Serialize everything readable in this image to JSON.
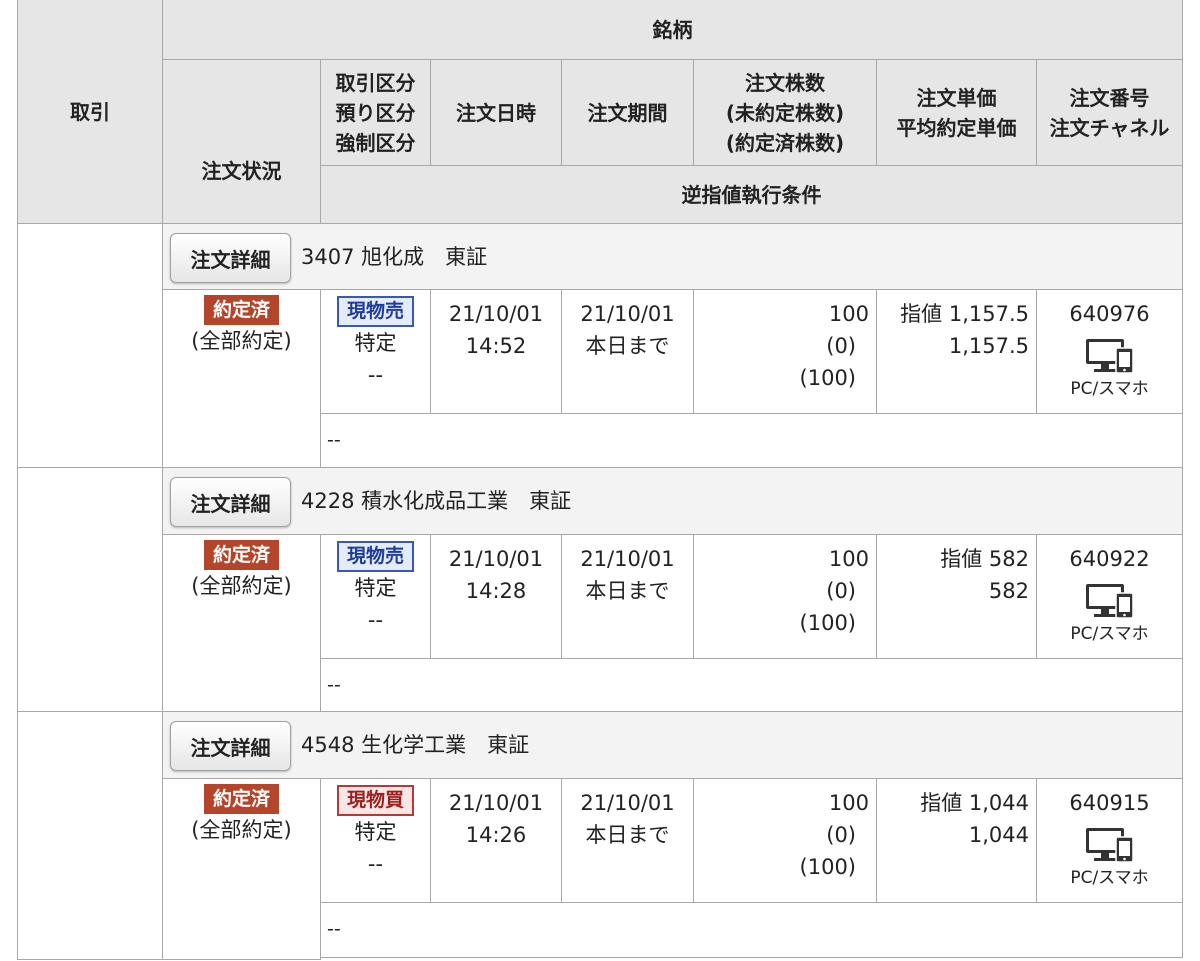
{
  "header": {
    "torihiki": "取引",
    "meigara": "銘柄",
    "status": "注文状況",
    "kubun": [
      "取引区分",
      "預り区分",
      "強制区分"
    ],
    "date": "注文日時",
    "period": "注文期間",
    "qty": [
      "注文株数",
      "(未約定株数)",
      "(約定済株数)"
    ],
    "price": [
      "注文単価",
      "平均約定単価"
    ],
    "number": [
      "注文番号",
      "注文チャネル"
    ],
    "condition": "逆指値執行条件"
  },
  "orders": [
    {
      "detail_button": "注文詳細",
      "stock": "3407 旭化成　東証",
      "status_badge": "約定済",
      "status_sub": "(全部約定)",
      "trade_badge": "現物売",
      "trade_type": "sell",
      "deposit": "特定",
      "forced": "--",
      "order_date": "21/10/01",
      "order_time": "14:52",
      "period_date": "21/10/01",
      "period_note": "本日まで",
      "qty": "100",
      "unfilled": "(0)",
      "filled": "(100)",
      "price": "指値 1,157.5",
      "avg_price": "1,157.5",
      "order_no": "640976",
      "channel": "PC/スマホ",
      "condition": "--"
    },
    {
      "detail_button": "注文詳細",
      "stock": "4228 積水化成品工業　東証",
      "status_badge": "約定済",
      "status_sub": "(全部約定)",
      "trade_badge": "現物売",
      "trade_type": "sell",
      "deposit": "特定",
      "forced": "--",
      "order_date": "21/10/01",
      "order_time": "14:28",
      "period_date": "21/10/01",
      "period_note": "本日まで",
      "qty": "100",
      "unfilled": "(0)",
      "filled": "(100)",
      "price": "指値 582",
      "avg_price": "582",
      "order_no": "640922",
      "channel": "PC/スマホ",
      "condition": "--"
    },
    {
      "detail_button": "注文詳細",
      "stock": "4548 生化学工業　東証",
      "status_badge": "約定済",
      "status_sub": "(全部約定)",
      "trade_badge": "現物買",
      "trade_type": "buy",
      "deposit": "特定",
      "forced": "--",
      "order_date": "21/10/01",
      "order_time": "14:26",
      "period_date": "21/10/01",
      "period_note": "本日まで",
      "qty": "100",
      "unfilled": "(0)",
      "filled": "(100)",
      "price": "指値 1,044",
      "avg_price": "1,044",
      "order_no": "640915",
      "channel": "PC/スマホ",
      "condition": "--"
    }
  ]
}
